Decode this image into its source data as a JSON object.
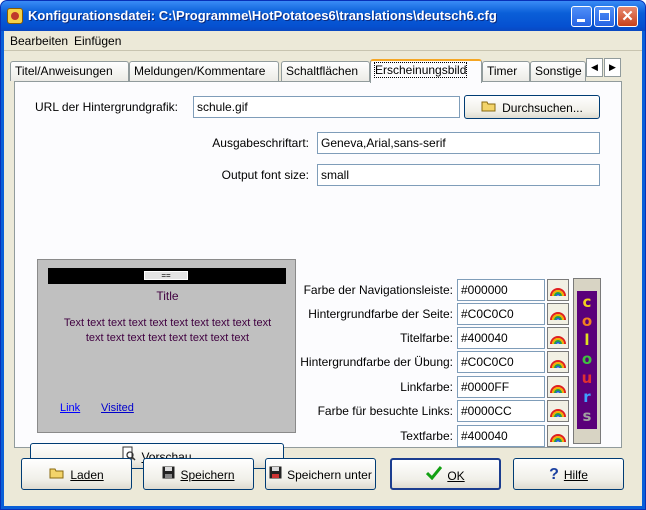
{
  "window": {
    "title": "Konfigurationsdatei: C:\\Programme\\HotPotatoes6\\translations\\deutsch6.cfg",
    "minimize_glyph": "",
    "close_glyph": "✕"
  },
  "menubar": {
    "items": [
      "Bearbeiten",
      "Einfügen"
    ]
  },
  "tabs": [
    {
      "label": "Titel/Anweisungen",
      "active": false
    },
    {
      "label": "Meldungen/Kommentare",
      "active": false
    },
    {
      "label": "Schaltflächen",
      "active": false
    },
    {
      "label": "Erscheinungsbild",
      "active": true
    },
    {
      "label": "Timer",
      "active": false
    },
    {
      "label": "Sonstige",
      "active": false
    }
  ],
  "tab_scroll": {
    "left": "◀",
    "right": "▶"
  },
  "appearance": {
    "bg_url_label": "URL der Hintergrundgrafik:",
    "bg_url_value": "schule.gif",
    "browse_label": "Durchsuchen...",
    "font_label": "Ausgabeschriftart:",
    "font_value": "Geneva,Arial,sans-serif",
    "size_label": "Output font size:",
    "size_value": "small"
  },
  "preview": {
    "nav_button": "==",
    "title": "Title",
    "text": "Text text text text text text text text text text text text text text text text text text",
    "link": "Link",
    "visited": "Visited",
    "button_label": "Vorschau",
    "background_color": "#C0C0C0",
    "title_color": "#400040",
    "link_color": "#0000FF",
    "visited_color": "#0000CC"
  },
  "colors": [
    {
      "label": "Farbe der Navigationsleiste:",
      "value": "#000000"
    },
    {
      "label": "Hintergrundfarbe der Seite:",
      "value": "#C0C0C0"
    },
    {
      "label": "Titelfarbe:",
      "value": "#400040"
    },
    {
      "label": "Hintergrundfarbe der Übung:",
      "value": "#C0C0C0"
    },
    {
      "label": "Linkfarbe:",
      "value": "#0000FF"
    },
    {
      "label": "Farbe für besuchte Links:",
      "value": "#0000CC"
    },
    {
      "label": "Textfarbe:",
      "value": "#400040"
    }
  ],
  "colours_banner": [
    "c",
    "o",
    "l",
    "o",
    "u",
    "r",
    "s"
  ],
  "footer": {
    "load": "Laden",
    "save": "Speichern",
    "save_as": "Speichern unter",
    "ok": "OK",
    "help": "Hilfe"
  }
}
